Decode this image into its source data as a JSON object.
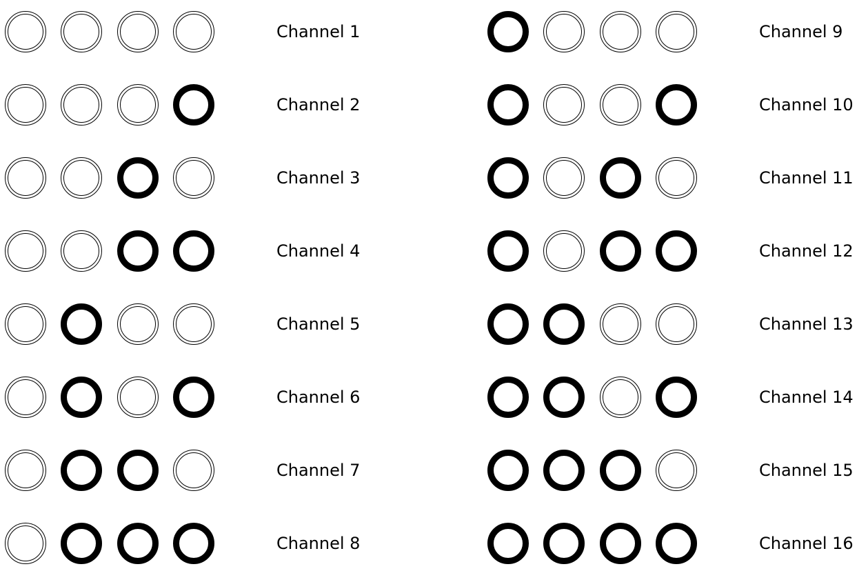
{
  "channels": [
    {
      "label": "Channel 1",
      "bits": [
        0,
        0,
        0,
        0
      ]
    },
    {
      "label": "Channel 2",
      "bits": [
        0,
        0,
        0,
        1
      ]
    },
    {
      "label": "Channel 3",
      "bits": [
        0,
        0,
        1,
        0
      ]
    },
    {
      "label": "Channel 4",
      "bits": [
        0,
        0,
        1,
        1
      ]
    },
    {
      "label": "Channel 5",
      "bits": [
        0,
        1,
        0,
        0
      ]
    },
    {
      "label": "Channel 6",
      "bits": [
        0,
        1,
        0,
        1
      ]
    },
    {
      "label": "Channel 7",
      "bits": [
        0,
        1,
        1,
        0
      ]
    },
    {
      "label": "Channel 8",
      "bits": [
        0,
        1,
        1,
        1
      ]
    },
    {
      "label": "Channel 9",
      "bits": [
        1,
        0,
        0,
        0
      ]
    },
    {
      "label": "Channel 10",
      "bits": [
        1,
        0,
        0,
        1
      ]
    },
    {
      "label": "Channel 11",
      "bits": [
        1,
        0,
        1,
        0
      ]
    },
    {
      "label": "Channel 12",
      "bits": [
        1,
        0,
        1,
        1
      ]
    },
    {
      "label": "Channel 13",
      "bits": [
        1,
        1,
        0,
        0
      ]
    },
    {
      "label": "Channel 14",
      "bits": [
        1,
        1,
        0,
        1
      ]
    },
    {
      "label": "Channel 15",
      "bits": [
        1,
        1,
        1,
        0
      ]
    },
    {
      "label": "Channel 16",
      "bits": [
        1,
        1,
        1,
        1
      ]
    }
  ]
}
